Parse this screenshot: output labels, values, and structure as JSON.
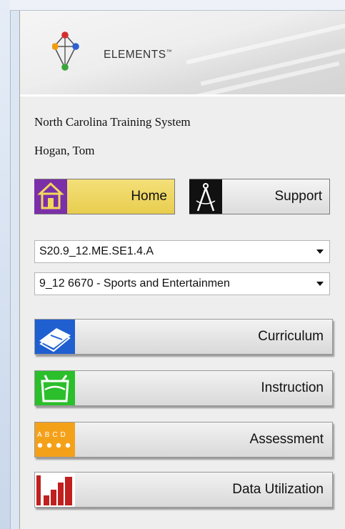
{
  "brand": {
    "name": "ELEMENTS",
    "trademark": "™"
  },
  "user": {
    "system": "North Carolina Training System",
    "name": "Hogan, Tom"
  },
  "buttons": {
    "home": "Home",
    "support": "Support"
  },
  "selects": {
    "standard": "S20.9_12.ME.SE1.4.A",
    "course": "9_12 6670 - Sports and Entertainmen"
  },
  "nav": [
    {
      "label": "Curriculum",
      "icon": "book-pencil-icon"
    },
    {
      "label": "Instruction",
      "icon": "teacher-icon"
    },
    {
      "label": "Assessment",
      "icon": "abcd-answer-sheet-icon"
    },
    {
      "label": "Data Utilization",
      "icon": "bar-chart-icon"
    }
  ],
  "colors": {
    "home_button": "#e8cd4e",
    "panel_bg": "#eeeeee",
    "curriculum_icon": "#1f5fd0",
    "instruction_icon": "#2bbf2b",
    "assessment_icon": "#f4a11a",
    "data_icon": "#c0201e"
  }
}
